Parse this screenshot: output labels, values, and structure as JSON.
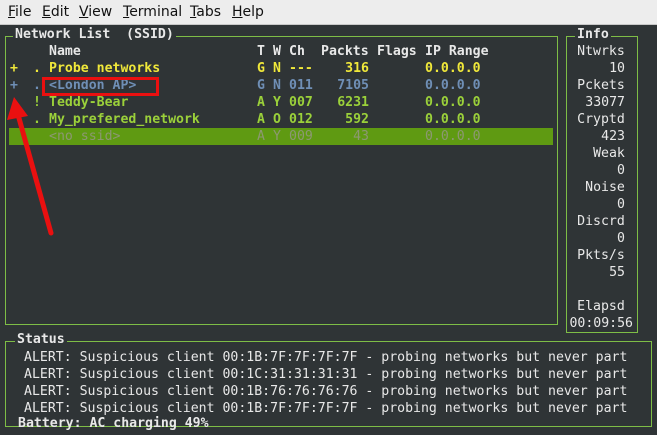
{
  "menu": [
    {
      "label": "File",
      "accel": "F",
      "rest": "ile"
    },
    {
      "label": "Edit",
      "accel": "E",
      "rest": "dit"
    },
    {
      "label": "View",
      "accel": "V",
      "rest": "iew"
    },
    {
      "label": "Terminal",
      "accel": "T",
      "rest": "erminal"
    },
    {
      "label": "Tabs",
      "accel": "T",
      "rest": "abs"
    },
    {
      "label": "Help",
      "accel": "H",
      "rest": "elp"
    }
  ],
  "network_list": {
    "title": "Network List  (SSID)",
    "headers": {
      "name": "Name",
      "t": "T",
      "w": "W",
      "ch": "Ch",
      "packets": "Packts",
      "flags": "Flags",
      "ip": "IP Range"
    },
    "rows": [
      {
        "mark1": "+",
        "mark2": ".",
        "name": "Probe networks",
        "t": "G",
        "w": "N",
        "ch": "---",
        "packets": "316",
        "flags": "",
        "ip": "0.0.0.0",
        "color": "yellow"
      },
      {
        "mark1": "+",
        "mark2": ".",
        "name": "<London AP>",
        "t": "G",
        "w": "N",
        "ch": "011",
        "packets": "7105",
        "flags": "",
        "ip": "0.0.0.0",
        "color": "blue"
      },
      {
        "mark1": "",
        "mark2": "!",
        "name": "Teddy-Bear",
        "t": "A",
        "w": "Y",
        "ch": "007",
        "packets": "6231",
        "flags": "",
        "ip": "0.0.0.0",
        "color": "green"
      },
      {
        "mark1": "",
        "mark2": ".",
        "name": "My_prefered_network",
        "t": "A",
        "w": "O",
        "ch": "012",
        "packets": "592",
        "flags": "",
        "ip": "0.0.0.0",
        "color": "green"
      },
      {
        "mark1": "",
        "mark2": "",
        "name": "<no ssid>",
        "t": "A",
        "w": "Y",
        "ch": "009",
        "packets": "43",
        "flags": "",
        "ip": "0.0.0.0",
        "color": "selected"
      }
    ]
  },
  "info": {
    "title": "Info",
    "items": [
      {
        "label": "Ntwrks",
        "value": "10"
      },
      {
        "label": "Pckets",
        "value": "33077"
      },
      {
        "label": "Cryptd",
        "value": "423"
      },
      {
        "label": "Weak",
        "value": "0"
      },
      {
        "label": "Noise",
        "value": "0"
      },
      {
        "label": "Discrd",
        "value": "0"
      },
      {
        "label": "Pkts/s",
        "value": "55"
      }
    ],
    "elapsed_label": "Elapsd",
    "elapsed_value": "00:09:56"
  },
  "status": {
    "title": "Status",
    "lines": [
      "ALERT: Suspicious client 00:1B:7F:7F:7F:7F - probing networks but never part",
      "ALERT: Suspicious client 00:1C:31:31:31:31 - probing networks but never part",
      "ALERT: Suspicious client 00:1B:76:76:76:76 - probing networks but never part",
      "ALERT: Suspicious client 00:1B:7F:7F:7F:7F - probing networks but never part"
    ],
    "battery": "Battery: AC charging 49%"
  },
  "colors": {
    "accent_border": "#7ebd46",
    "selected_row": "#5f9a12",
    "annotation": "#ea1010"
  }
}
